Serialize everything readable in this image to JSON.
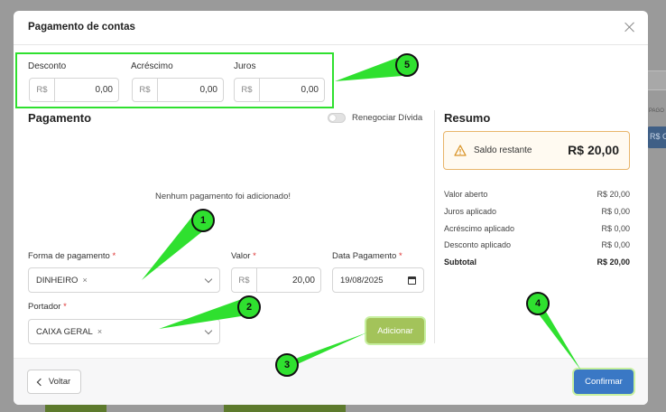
{
  "modal": {
    "title": "Pagamento de contas"
  },
  "adjustments": [
    {
      "label": "Desconto",
      "prefix": "R$",
      "value": "0,00"
    },
    {
      "label": "Acréscimo",
      "prefix": "R$",
      "value": "0,00"
    },
    {
      "label": "Juros",
      "prefix": "R$",
      "value": "0,00"
    }
  ],
  "payment": {
    "title": "Pagamento",
    "toggle_label": "Renegociar Dívida",
    "empty_message": "Nenhum pagamento foi adicionado!",
    "method": {
      "label": "Forma de pagamento",
      "value": "DINHEIRO",
      "remove": "×"
    },
    "amount": {
      "label": "Valor",
      "prefix": "R$",
      "value": "20,00"
    },
    "date": {
      "label": "Data Pagamento",
      "value": "19/08/2025"
    },
    "holder": {
      "label": "Portador",
      "value": "CAIXA GERAL",
      "remove": "×"
    },
    "required_mark": "*",
    "add_button": "Adicionar"
  },
  "summary": {
    "title": "Resumo",
    "balance_label": "Saldo restante",
    "balance_value": "R$ 20,00",
    "rows": [
      {
        "label": "Valor aberto",
        "value": "R$ 20,00"
      },
      {
        "label": "Juros aplicado",
        "value": "R$ 0,00"
      },
      {
        "label": "Acréscimo aplicado",
        "value": "R$ 0,00"
      },
      {
        "label": "Desconto aplicado",
        "value": "R$ 0,00"
      },
      {
        "label": "Subtotal",
        "value": "R$ 20,00"
      }
    ]
  },
  "footer": {
    "back_label": "Voltar",
    "confirm_label": "Confirmar"
  },
  "annotations": [
    "1",
    "2",
    "3",
    "4",
    "5"
  ],
  "colors": {
    "annotation": "#2fe02f",
    "add_button": "#a3c35a",
    "confirm_button": "#3a78c5",
    "warning_border": "#e8b56a",
    "required": "#d33"
  },
  "background": {
    "right_label": "PAGO",
    "right_button": "R$ C"
  }
}
